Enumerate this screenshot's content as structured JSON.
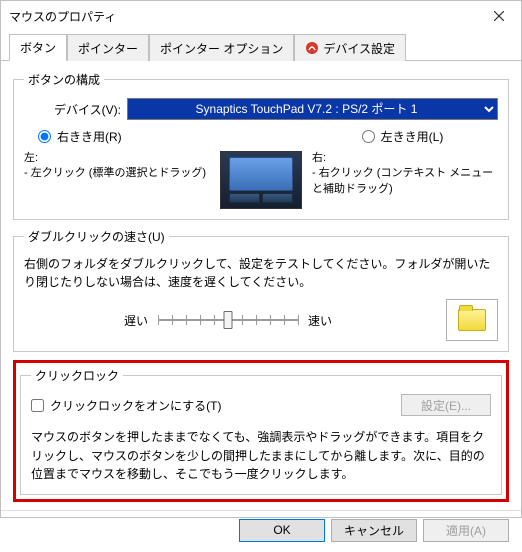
{
  "window": {
    "title": "マウスのプロパティ"
  },
  "tabs": {
    "items": [
      {
        "label": "ボタン"
      },
      {
        "label": "ポインター"
      },
      {
        "label": "ポインター オプション"
      },
      {
        "label": "デバイス設定"
      }
    ]
  },
  "button_config": {
    "legend": "ボタンの構成",
    "device_label": "デバイス(V):",
    "device_value": "Synaptics TouchPad V7.2 : PS/2 ポート 1",
    "right_handed": "右きき用(R)",
    "left_handed": "左きき用(L)",
    "left_heading": "左:",
    "left_line": "- 左クリック (標準の選択とドラッグ)",
    "right_heading": "右:",
    "right_line": "- 右クリック (コンテキスト メニューと補助ドラッグ)"
  },
  "dblclick": {
    "legend": "ダブルクリックの速さ(U)",
    "text": "右側のフォルダをダブルクリックして、設定をテストしてください。フォルダが開いたり閉じたりしない場合は、速度を遅くしてください。",
    "slow": "遅い",
    "fast": "速い",
    "slider_value": 5,
    "slider_max": 10
  },
  "clicklock": {
    "legend": "クリックロック",
    "checkbox": "クリックロックをオンにする(T)",
    "settings_button": "設定(E)...",
    "text": "マウスのボタンを押したままでなくても、強調表示やドラッグができます。項目をクリックし、マウスのボタンを少しの間押したままにしてから離します。次に、目的の位置までマウスを移動し、そこでもう一度クリックします。"
  },
  "buttons": {
    "ok": "OK",
    "cancel": "キャンセル",
    "apply": "適用(A)"
  }
}
